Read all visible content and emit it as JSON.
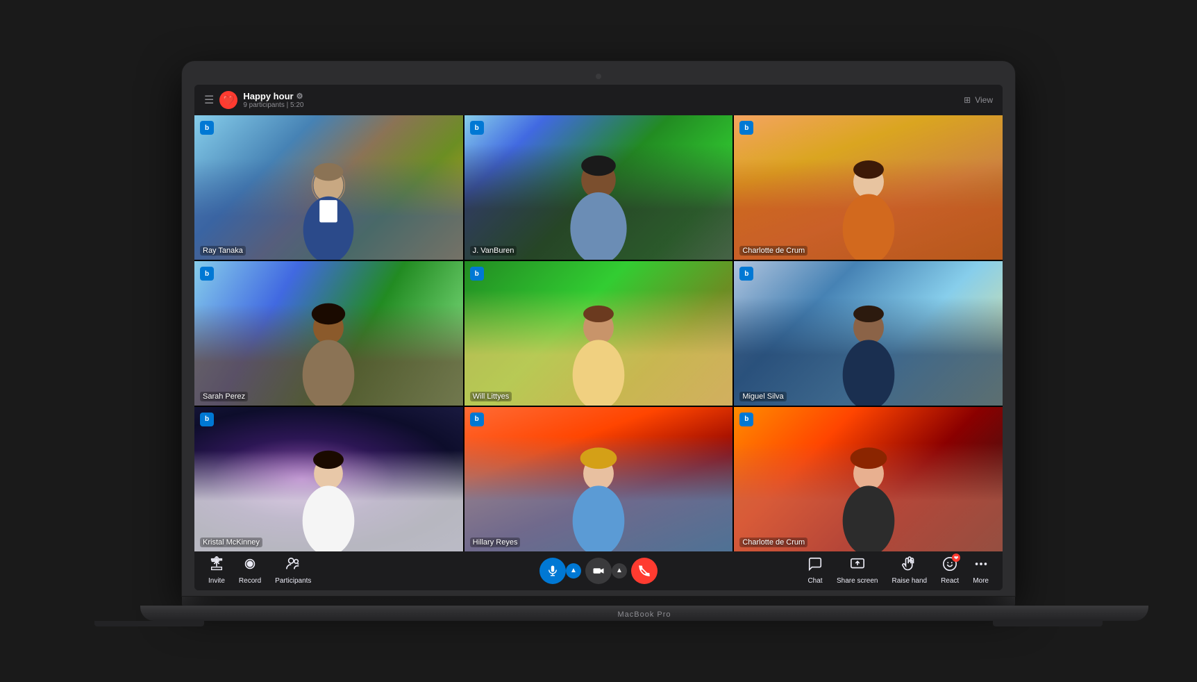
{
  "meeting": {
    "title": "Happy hour",
    "participants_label": "9 participants | 5:20",
    "gear_icon": "⚙",
    "view_label": "View"
  },
  "header": {
    "menu_icon": "☰",
    "view_grid_icon": "⊞"
  },
  "participants": [
    {
      "id": 1,
      "name": "Ray Tanaka",
      "bg_class": "tile-bg-1",
      "person_class": "tile-person-1"
    },
    {
      "id": 2,
      "name": "J. VanBuren",
      "bg_class": "tile-bg-2",
      "person_class": "tile-person-2"
    },
    {
      "id": 3,
      "name": "Charlotte de Crum",
      "bg_class": "tile-bg-3",
      "person_class": "tile-person-3"
    },
    {
      "id": 4,
      "name": "Sarah Perez",
      "bg_class": "tile-bg-4",
      "person_class": "tile-person-4"
    },
    {
      "id": 5,
      "name": "Will Littyes",
      "bg_class": "tile-bg-5",
      "person_class": "tile-person-5"
    },
    {
      "id": 6,
      "name": "Miguel Silva",
      "bg_class": "tile-bg-6",
      "person_class": "tile-person-6"
    },
    {
      "id": 7,
      "name": "Kristal McKinney",
      "bg_class": "tile-bg-7",
      "person_class": "tile-person-7"
    },
    {
      "id": 8,
      "name": "Hillary Reyes",
      "bg_class": "tile-bg-8",
      "person_class": "tile-person-8"
    },
    {
      "id": 9,
      "name": "Charlotte de Crum",
      "bg_class": "tile-bg-9",
      "person_class": "tile-person-9"
    }
  ],
  "toolbar": {
    "invite_label": "Invite",
    "record_label": "Record",
    "participants_label": "Participants",
    "chat_label": "Chat",
    "share_screen_label": "Share screen",
    "raise_hand_label": "Raise hand",
    "react_label": "React",
    "more_label": "More"
  },
  "colors": {
    "accent_blue": "#0078D4",
    "red": "#ff3b30",
    "toolbar_bg": "#1c1c1e",
    "text_primary": "#ffffff",
    "text_secondary": "#8e8e93"
  },
  "laptop_label": "MacBook Pro"
}
